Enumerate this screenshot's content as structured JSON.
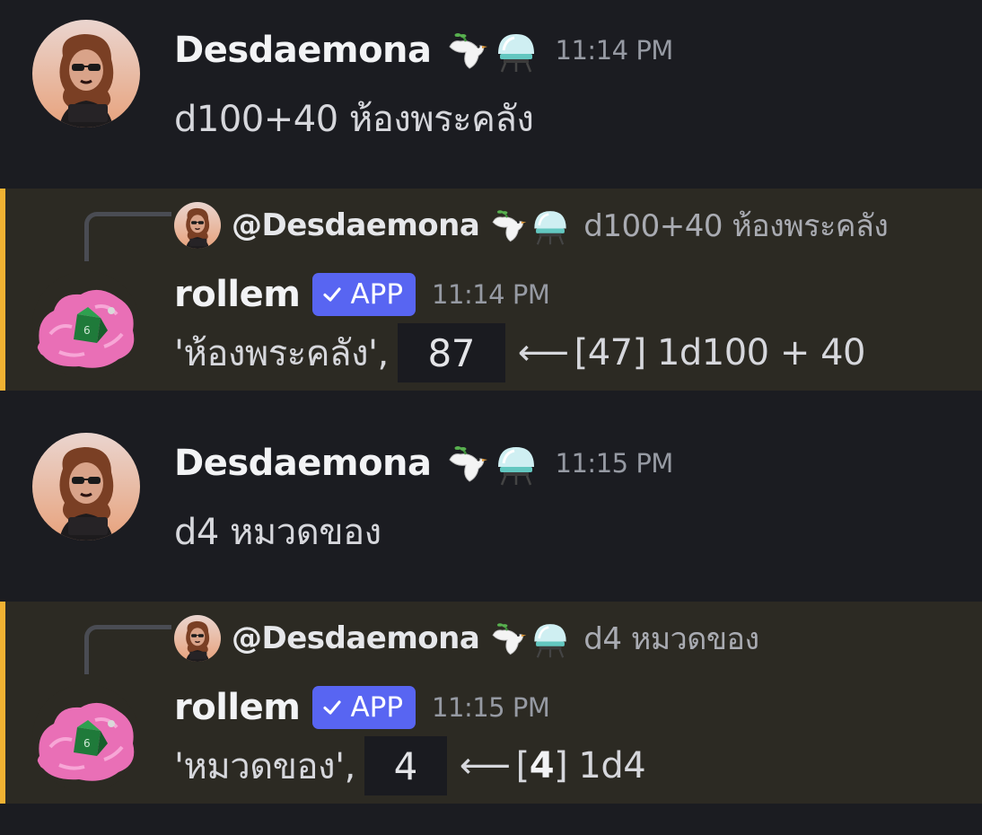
{
  "messages": [
    {
      "type": "user",
      "username": "Desdaemona",
      "emoji_badges": [
        "dove-icon",
        "crystal-ball-icon"
      ],
      "time": "11:14 PM",
      "text": "d100+40 ห้องพระคลัง"
    },
    {
      "type": "bot",
      "reply": {
        "mention": "@Desdaemona",
        "emoji_badges": [
          "dove-icon",
          "crystal-ball-icon"
        ],
        "text": "d100+40 ห้องพระคลัง"
      },
      "username": "rollem",
      "badge": "APP",
      "time": "11:14 PM",
      "result_prefix": "'ห้องพระคลัง',",
      "result_value": "87",
      "arrow": "⟵",
      "detail_open": "[",
      "detail_roll": "47",
      "detail_close": "] 1d100 + 40"
    },
    {
      "type": "user",
      "username": "Desdaemona",
      "emoji_badges": [
        "dove-icon",
        "crystal-ball-icon"
      ],
      "time": "11:15 PM",
      "text": "d4 หมวดของ"
    },
    {
      "type": "bot",
      "reply": {
        "mention": "@Desdaemona",
        "emoji_badges": [
          "dove-icon",
          "crystal-ball-icon"
        ],
        "text": "d4 หมวดของ"
      },
      "username": "rollem",
      "badge": "APP",
      "time": "11:15 PM",
      "result_prefix": "'หมวดของ',",
      "result_value": "4",
      "arrow": "⟵",
      "detail_open": "[",
      "detail_roll": "4",
      "detail_close": "] 1d4"
    }
  ],
  "colors": {
    "background": "#1b1c21",
    "bot_highlight": "#2c2a23",
    "mention_bar": "#f0b232",
    "app_badge": "#5865f2",
    "timestamp": "#969aa3"
  }
}
